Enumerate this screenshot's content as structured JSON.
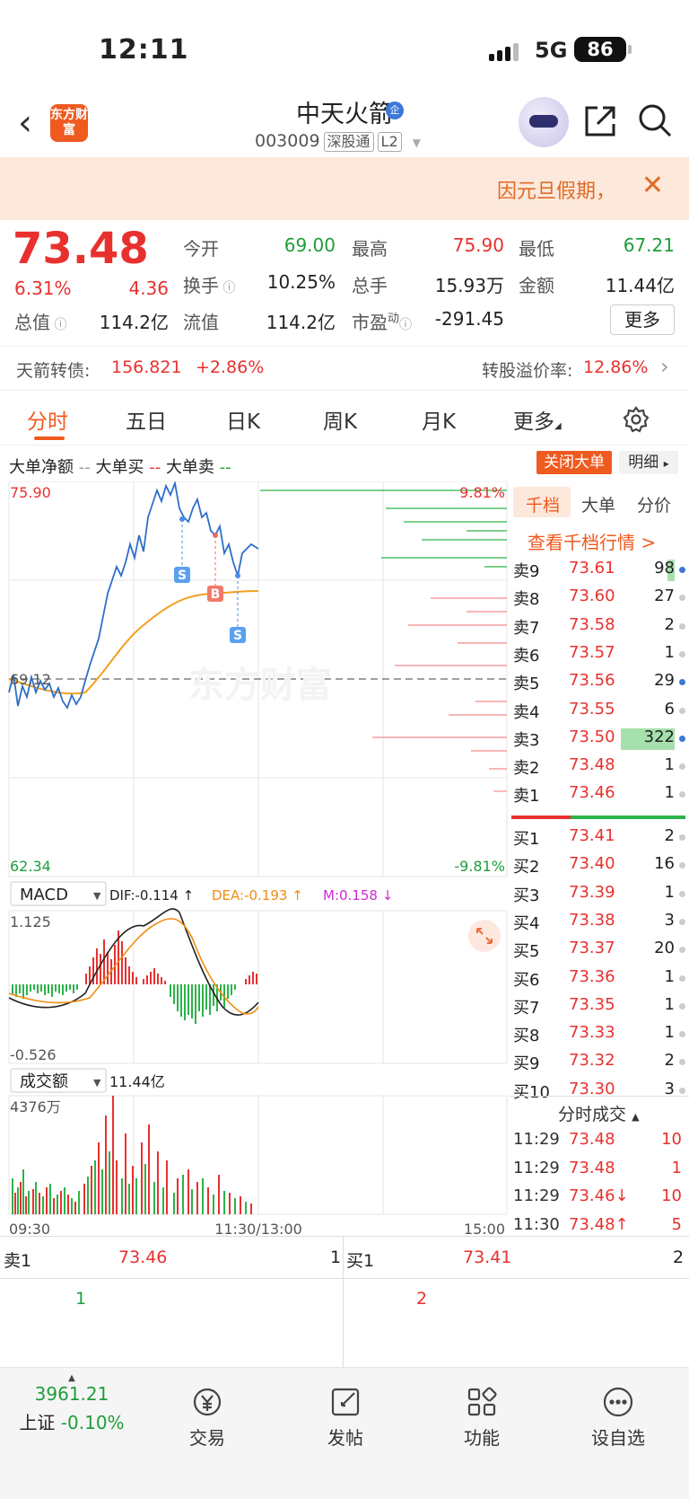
{
  "status": {
    "time": "12:11",
    "network": "5G",
    "battery": "86"
  },
  "header": {
    "logo_text": "东方财富",
    "stock_name": "中天火箭",
    "badge": "企",
    "code": "003009",
    "tags": [
      "深股通",
      "L2"
    ]
  },
  "notice": {
    "text": "因元旦假期，",
    "close": "✕"
  },
  "quote": {
    "price": "73.48",
    "change_pct": "6.31%",
    "change": "4.36",
    "fields": [
      {
        "label": "今开",
        "value": "69.00",
        "color": "#1f9d3a"
      },
      {
        "label": "最高",
        "value": "75.90",
        "color": "#e8312f"
      },
      {
        "label": "最低",
        "value": "67.21",
        "color": "#1f9d3a"
      },
      {
        "label": "换手",
        "value": "10.25%",
        "color": "#222222"
      },
      {
        "label": "总手",
        "value": "15.93万",
        "color": "#222222"
      },
      {
        "label": "金额",
        "value": "11.44亿",
        "color": "#222222"
      },
      {
        "label": "总值",
        "value": "114.2亿",
        "color": "#222222"
      },
      {
        "label": "流值",
        "value": "114.2亿",
        "color": "#222222"
      },
      {
        "label": "市盈",
        "sup": "动",
        "value": "-291.45",
        "color": "#222222"
      }
    ],
    "more": "更多"
  },
  "bond": {
    "label": "天箭转债:",
    "price": "156.821",
    "change": "+2.86%",
    "premium_label": "转股溢价率:",
    "premium": "12.86%"
  },
  "tabs": [
    "分时",
    "五日",
    "日K",
    "周K",
    "月K",
    "更多"
  ],
  "chart": {
    "legend": {
      "net": "大单净额",
      "buy": "大单买",
      "sell": "大单卖"
    },
    "close_big": "关闭大单",
    "detail": "明细",
    "price_high": "75.90",
    "price_low": "62.34",
    "prev_close": "69.12",
    "pct_high": "9.81%",
    "pct_low": "-9.81%",
    "markers": [
      "S",
      "B",
      "S"
    ],
    "watermark": "东方财富",
    "macd": {
      "name": "MACD",
      "dif": "DIF:-0.114 ↑",
      "dea": "DEA:-0.193 ↑",
      "m": "M:0.158 ↓",
      "high": "1.125",
      "low": "-0.526"
    },
    "volume": {
      "name": "成交额",
      "total": "11.44亿",
      "high": "4376万"
    },
    "xlabels": [
      "09:30",
      "11:30/13:00",
      "15:00"
    ]
  },
  "book": {
    "tabs": [
      "千档",
      "大单",
      "分价"
    ],
    "link": "查看千档行情 >",
    "asks": [
      {
        "label": "卖9",
        "price": "73.61",
        "vol": "98",
        "dot": "blue"
      },
      {
        "label": "卖8",
        "price": "73.60",
        "vol": "27",
        "dot": "gray"
      },
      {
        "label": "卖7",
        "price": "73.58",
        "vol": "2",
        "dot": "gray"
      },
      {
        "label": "卖6",
        "price": "73.57",
        "vol": "1",
        "dot": "gray"
      },
      {
        "label": "卖5",
        "price": "73.56",
        "vol": "29",
        "dot": "blue"
      },
      {
        "label": "卖4",
        "price": "73.55",
        "vol": "6",
        "dot": "gray"
      },
      {
        "label": "卖3",
        "price": "73.50",
        "vol": "322",
        "dot": "blue"
      },
      {
        "label": "卖2",
        "price": "73.48",
        "vol": "1",
        "dot": "gray"
      },
      {
        "label": "卖1",
        "price": "73.46",
        "vol": "1",
        "dot": "gray"
      }
    ],
    "bids": [
      {
        "label": "买1",
        "price": "73.41",
        "vol": "2",
        "dot": "gray"
      },
      {
        "label": "买2",
        "price": "73.40",
        "vol": "16",
        "dot": "gray"
      },
      {
        "label": "买3",
        "price": "73.39",
        "vol": "1",
        "dot": "gray"
      },
      {
        "label": "买4",
        "price": "73.38",
        "vol": "3",
        "dot": "gray"
      },
      {
        "label": "买5",
        "price": "73.37",
        "vol": "20",
        "dot": "gray"
      },
      {
        "label": "买6",
        "price": "73.36",
        "vol": "1",
        "dot": "gray"
      },
      {
        "label": "买7",
        "price": "73.35",
        "vol": "1",
        "dot": "gray"
      },
      {
        "label": "买8",
        "price": "73.33",
        "vol": "1",
        "dot": "gray"
      },
      {
        "label": "买9",
        "price": "73.32",
        "vol": "2",
        "dot": "gray"
      },
      {
        "label": "买10",
        "price": "73.30",
        "vol": "3",
        "dot": "gray"
      }
    ],
    "trades_title": "分时成交",
    "trades": [
      {
        "time": "11:29",
        "price": "73.48",
        "vol": "10"
      },
      {
        "time": "11:29",
        "price": "73.48",
        "vol": "1"
      },
      {
        "time": "11:29",
        "price": "73.46↓",
        "vol": "10"
      },
      {
        "time": "11:30",
        "price": "73.48↑",
        "vol": "5"
      }
    ]
  },
  "bottom_quote": {
    "sell_label": "卖1",
    "sell_price": "73.46",
    "sell_vol": "1",
    "buy_label": "买1",
    "buy_price": "73.41",
    "buy_vol": "2",
    "left_value": "1",
    "right_value": "2"
  },
  "nav": {
    "index_value": "3961.21",
    "index_name": "上证",
    "index_change": "-0.10%",
    "items": [
      "交易",
      "发帖",
      "功能",
      "设自选"
    ]
  }
}
